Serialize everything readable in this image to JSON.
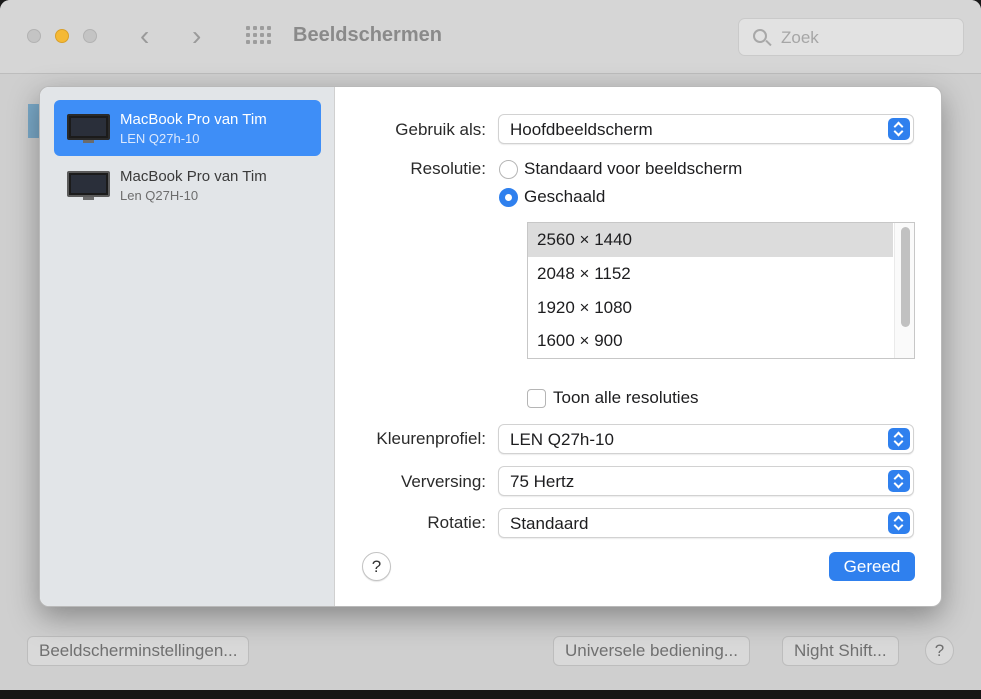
{
  "window": {
    "title": "Beeldschermen",
    "search_placeholder": "Zoek",
    "nav_back_icon": "chevron-left-icon",
    "nav_forward_icon": "chevron-right-icon",
    "bottom_buttons": {
      "display_settings": "Beeldscherminstellingen...",
      "universal_control": "Universele bediening...",
      "night_shift": "Night Shift...",
      "help": "?"
    }
  },
  "sidebar": {
    "items": [
      {
        "name": "MacBook Pro van Tim",
        "model": "LEN Q27h-10",
        "selected": true
      },
      {
        "name": "MacBook Pro van Tim",
        "model": "Len Q27H-10",
        "selected": false
      }
    ]
  },
  "settings": {
    "use_as": {
      "label": "Gebruik als:",
      "value": "Hoofdbeeldscherm"
    },
    "resolution": {
      "label": "Resolutie:",
      "options": [
        {
          "label": "Standaard voor beeldscherm",
          "selected": false
        },
        {
          "label": "Geschaald",
          "selected": true
        }
      ],
      "scaled_list": [
        "2560 × 1440",
        "2048 × 1152",
        "1920 × 1080",
        "1600 × 900"
      ],
      "selected_index": 0,
      "show_all_label": "Toon alle resoluties",
      "show_all_checked": false
    },
    "color_profile": {
      "label": "Kleurenprofiel:",
      "value": "LEN Q27h-10"
    },
    "refresh": {
      "label": "Verversing:",
      "value": "75 Hertz"
    },
    "rotation": {
      "label": "Rotatie:",
      "value": "Standaard"
    }
  },
  "sheet_buttons": {
    "help": "?",
    "done": "Gereed"
  },
  "colors": {
    "accent": "#2f80ee",
    "sidebar_selected": "#3e8ef7"
  }
}
